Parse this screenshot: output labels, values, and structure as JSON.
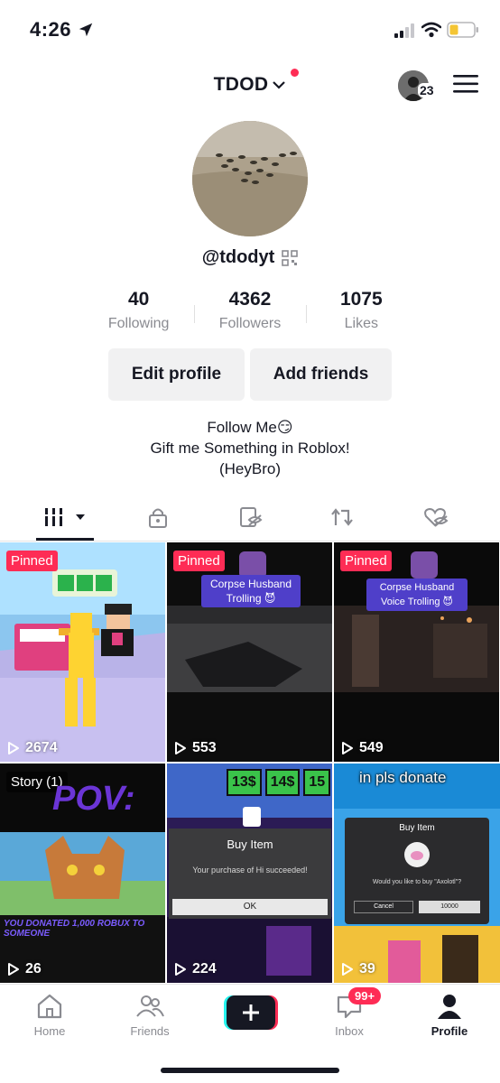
{
  "status_bar": {
    "time": "4:26"
  },
  "header": {
    "title": "TDOD",
    "avatar_count": "23"
  },
  "profile": {
    "handle": "@tdodyt",
    "stats": [
      {
        "value": "40",
        "label": "Following"
      },
      {
        "value": "4362",
        "label": "Followers"
      },
      {
        "value": "1075",
        "label": "Likes"
      }
    ],
    "edit_label": "Edit profile",
    "add_label": "Add friends",
    "bio_lines": [
      "Follow Me😏",
      "Gift me Something in Roblox!",
      "(HeyBro)"
    ]
  },
  "videos": [
    {
      "badge": "Pinned",
      "views": "2674"
    },
    {
      "badge": "Pinned",
      "views": "553",
      "caption": "Corpse Husband Trolling 😈"
    },
    {
      "badge": "Pinned",
      "views": "549",
      "caption": "Corpse Husband Voice Trolling 😈"
    },
    {
      "badge": "Story (1)",
      "views": "26",
      "overlay": "POV:",
      "subtitle": "YOU DONATED 1,000 ROBUX TO SOMEONE"
    },
    {
      "badge": "",
      "views": "224",
      "dialog_title": "Buy Item",
      "dialog_text": "Your purchase of Hi succeeded!",
      "dialog_ok": "OK",
      "prices": [
        "13$",
        "14$",
        "15"
      ]
    },
    {
      "badge": "",
      "views": "39",
      "top_text": "in pls donate",
      "dialog_title": "Buy Item",
      "dialog_text": "Would you like to buy \"Axolotl\"?",
      "dialog_cancel": "Cancel",
      "dialog_price": "10000",
      "item_name": "Axolotl"
    }
  ],
  "bottom_nav": {
    "items": [
      {
        "label": "Home"
      },
      {
        "label": "Friends"
      },
      {
        "label": "Inbox"
      },
      {
        "label": "Profile"
      }
    ],
    "inbox_badge": "99+"
  },
  "colors": {
    "accent": "#fe2c55",
    "text": "#161823",
    "muted": "#8a8b91"
  }
}
